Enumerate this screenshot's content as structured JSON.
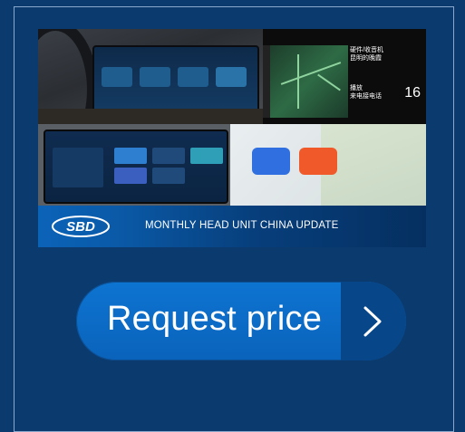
{
  "banner": {
    "caption": "MONTHLY HEAD UNIT CHINA UPDATE",
    "logo_text": "SBD",
    "nav_screen": {
      "line1": "硬件/收音机",
      "line2": "昆明的晚霞",
      "line3": "播放",
      "line4": "来电接电话",
      "number": "16"
    }
  },
  "cta": {
    "label": "Request price",
    "icon": "chevron-right-icon"
  },
  "colors": {
    "background": "#0b3a6f",
    "cta_blue": "#0a68c2",
    "cta_dark": "#074789"
  }
}
